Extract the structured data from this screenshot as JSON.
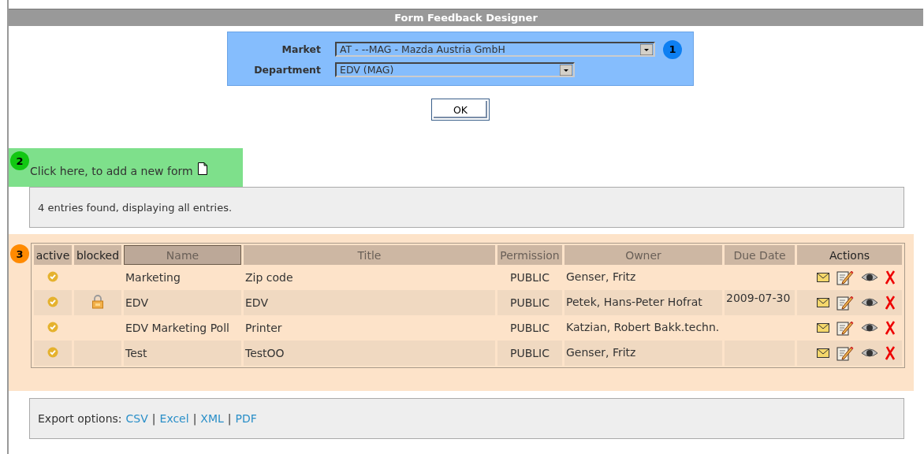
{
  "window": {
    "title": "Form Feedback Designer"
  },
  "filter": {
    "badge": "1",
    "fields": [
      {
        "label": "Market",
        "value": "AT - --MAG - Mazda Austria GmbH",
        "wide": true
      },
      {
        "label": "Department",
        "value": "EDV (MAG)",
        "wide": false
      }
    ],
    "ok_button": "OK"
  },
  "add_form": {
    "badge": "2",
    "label": "Click here, to add a new form"
  },
  "result_info": "4 entries found, displaying all entries.",
  "table": {
    "badge": "3",
    "columns": [
      {
        "label": "active",
        "sortable": false,
        "sorted": false
      },
      {
        "label": "blocked",
        "sortable": false,
        "sorted": false
      },
      {
        "label": "Name",
        "sortable": true,
        "sorted": true
      },
      {
        "label": "Title",
        "sortable": true,
        "sorted": false
      },
      {
        "label": "Permission",
        "sortable": true,
        "sorted": false
      },
      {
        "label": "Owner",
        "sortable": true,
        "sorted": false
      },
      {
        "label": "Due Date",
        "sortable": true,
        "sorted": false
      },
      {
        "label": "Actions",
        "sortable": false,
        "sorted": false
      }
    ],
    "rows": [
      {
        "active": true,
        "blocked": false,
        "name": "Marketing",
        "title": "Zip code",
        "permission": "PUBLIC",
        "owner": "Genser, Fritz",
        "due_date": ""
      },
      {
        "active": true,
        "blocked": true,
        "name": "EDV",
        "title": "EDV",
        "permission": "PUBLIC",
        "owner": "Petek, Hans-Peter Hofrat",
        "due_date": "2009-07-30"
      },
      {
        "active": true,
        "blocked": false,
        "name": "EDV Marketing Poll",
        "title": "Printer",
        "permission": "PUBLIC",
        "owner": "Katzian, Robert Bakk.techn.",
        "due_date": ""
      },
      {
        "active": true,
        "blocked": false,
        "name": "Test",
        "title": "TestOO",
        "permission": "PUBLIC",
        "owner": "Genser, Fritz",
        "due_date": ""
      }
    ]
  },
  "export": {
    "label": "Export options:",
    "separator": "|",
    "links": [
      "CSV",
      "Excel",
      "XML",
      "PDF"
    ]
  }
}
